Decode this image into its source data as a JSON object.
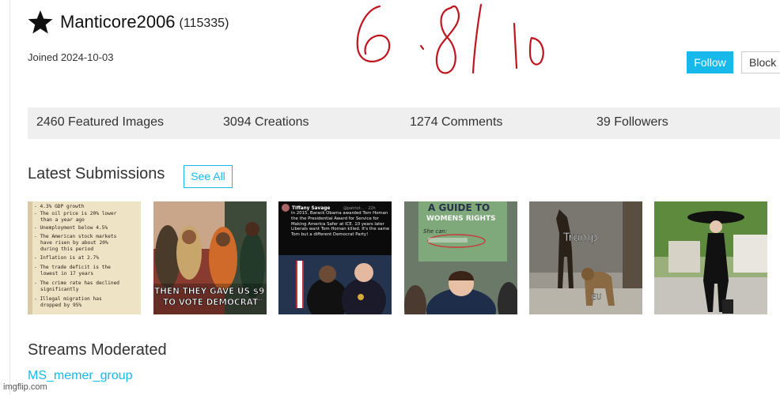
{
  "profile": {
    "username": "Manticore2006",
    "points": "(115335)",
    "joined": "Joined 2024-10-03",
    "badge_icon": "star-icon"
  },
  "actions": {
    "follow_label": "Follow",
    "block_label": "Block",
    "follow_color": "#16b9ea"
  },
  "annotation": {
    "handwritten_text": "6.8 | 10",
    "color": "#c0141e"
  },
  "stats": [
    {
      "label": "2460 Featured Images"
    },
    {
      "label": "3094 Creations"
    },
    {
      "label": "1274 Comments"
    },
    {
      "label": "39 Followers"
    }
  ],
  "latest_submissions": {
    "title": "Latest Submissions",
    "see_all_label": "See All",
    "thumbnails": [
      {
        "lines": [
          "- 4.3% GDP growth",
          "- The oil price is 20% lower",
          "than a year ago",
          "- Unemployment below 4.5%",
          "- The American stock markets",
          "have risen by about 20%",
          "during this period",
          "- Inflation is at 2.7%",
          "- The trade deficit is the",
          "lowest in 17 years",
          "- The crime rate has declined",
          "significantly",
          "- Illegal migration has",
          "dropped by 95%"
        ]
      },
      {
        "caption_line1": "THEN THEY GAVE US $9 BI",
        "caption_line2": "TO VOTE DEMOCRAT\""
      },
      {
        "author": "Tiffany Savage",
        "handle": "@patriot... · 22h",
        "tweet": "In 2015, Barack Obama awarded Tom Homan the the Presidential Award for Service for Making America Safer at ICE. 10 years later Liberals want Tom Homan killed. It's the same Tom but a different Democrat Party!"
      },
      {
        "sign_top": "A GUIDE TO",
        "sign_mid": "WOMENS RIGHTS",
        "sign_she_can": "She can:"
      },
      {
        "label_top": "Trump",
        "label_bottom": "EU"
      },
      {}
    ]
  },
  "streams": {
    "title": "Streams Moderated",
    "items": [
      "MS_memer_group"
    ]
  },
  "watermark": "imgflip.com"
}
